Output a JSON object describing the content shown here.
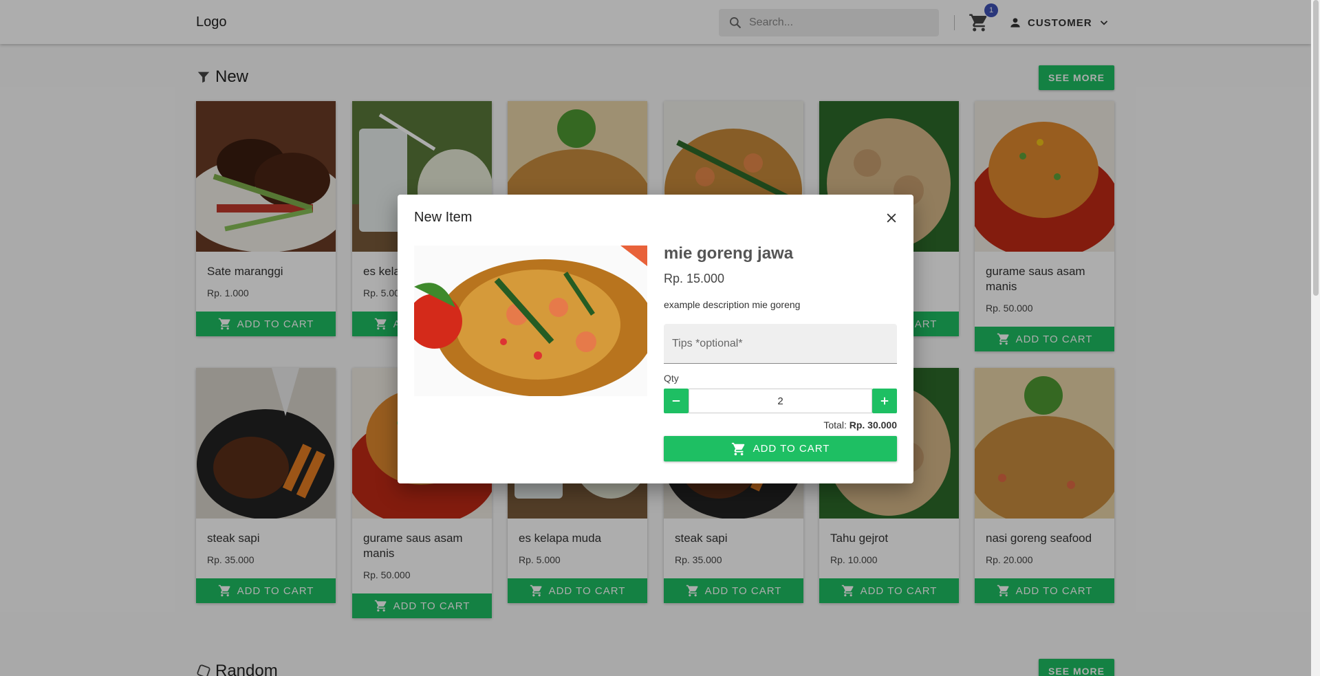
{
  "header": {
    "logo": "Logo",
    "search_placeholder": "Search...",
    "cart_count": "1",
    "user_label": "CUSTOMER"
  },
  "sections": {
    "new_title": "New",
    "random_title": "Random",
    "see_more_label": "SEE MORE"
  },
  "add_to_cart_label": "ADD TO CART",
  "products_row1": [
    {
      "name": "Sate maranggi",
      "price": "Rp. 1.000"
    },
    {
      "name": "es kela",
      "price": "Rp. 5.00"
    },
    {
      "name": "",
      "price": ""
    },
    {
      "name": "",
      "price": ""
    },
    {
      "name": "",
      "price": ""
    },
    {
      "name": "gurame saus asam manis",
      "price": "Rp. 50.000"
    }
  ],
  "products_row2": [
    {
      "name": "steak sapi",
      "price": "Rp. 35.000"
    },
    {
      "name": "gurame saus asam manis",
      "price": "Rp. 50.000"
    },
    {
      "name": "es kelapa muda",
      "price": "Rp. 5.000"
    },
    {
      "name": "steak sapi",
      "price": "Rp. 35.000"
    },
    {
      "name": "Tahu gejrot",
      "price": "Rp. 10.000"
    },
    {
      "name": "nasi goreng seafood",
      "price": "Rp. 20.000"
    }
  ],
  "dialog": {
    "title": "New Item",
    "item_name": "mie goreng jawa",
    "price": "Rp. 15.000",
    "description": "example description mie goreng",
    "tips_placeholder": "Tips *optional*",
    "qty_label": "Qty",
    "qty_value": "2",
    "total_prefix": "Total:",
    "total_value": "Rp. 30.000",
    "add_to_cart_label": "ADD TO CART"
  },
  "colors": {
    "accent": "#1ebf63",
    "badge": "#3f51b5",
    "overlay": "rgba(0,0,0,0.32)"
  },
  "icons": [
    "search-icon",
    "cart-icon",
    "person-icon",
    "chevron-down-icon",
    "filter-icon",
    "dice-icon",
    "close-icon",
    "minus-icon",
    "plus-icon"
  ]
}
